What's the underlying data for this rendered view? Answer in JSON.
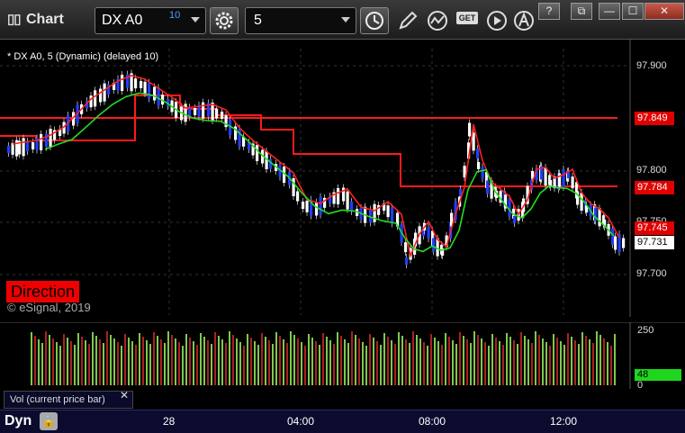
{
  "window": {
    "title": "Chart",
    "symbol": "DX A0",
    "symbol_superscript": "10",
    "interval": "5",
    "buttons": {
      "help": "?",
      "restore": "⧉",
      "minimize": "—",
      "maximize": "☐",
      "close": "✕"
    },
    "get_label": "GET"
  },
  "chart": {
    "caption": "* DX A0, 5 (Dynamic) (delayed 10)",
    "watermark": "© eSignal, 2019",
    "direction_label": "Direction",
    "price_ticks": [
      "97.900",
      "97.800",
      "97.750",
      "97.700"
    ],
    "price_tags": [
      {
        "value": "97.849",
        "bg": "#e00000",
        "fg": "#ffffff"
      },
      {
        "value": "97.784",
        "bg": "#e00000",
        "fg": "#ffffff"
      },
      {
        "value": "97.745",
        "bg": "#e00000",
        "fg": "#ffffff"
      },
      {
        "value": "97.731",
        "bg": "#ffffff",
        "fg": "#000000"
      }
    ]
  },
  "volume": {
    "ticks": [
      "250",
      "0"
    ],
    "current": "48",
    "legend": "Vol (current price bar)",
    "legend_close": "✕"
  },
  "time_axis": {
    "mode": "Dyn",
    "labels": [
      "28",
      "04:00",
      "08:00",
      "12:00"
    ]
  },
  "colors": {
    "up": "#ffffff",
    "down": "#1f3fff",
    "ma_red": "#ff1f1f",
    "ma_green": "#22dd22",
    "stop_line": "#ff1a1a",
    "vol_up": "#7ec850",
    "vol_down": "#b02020"
  },
  "icons": [
    "settings-gear-icon",
    "clock-icon",
    "pencil-icon",
    "studies-icon",
    "play-icon",
    "alert-icon"
  ]
}
